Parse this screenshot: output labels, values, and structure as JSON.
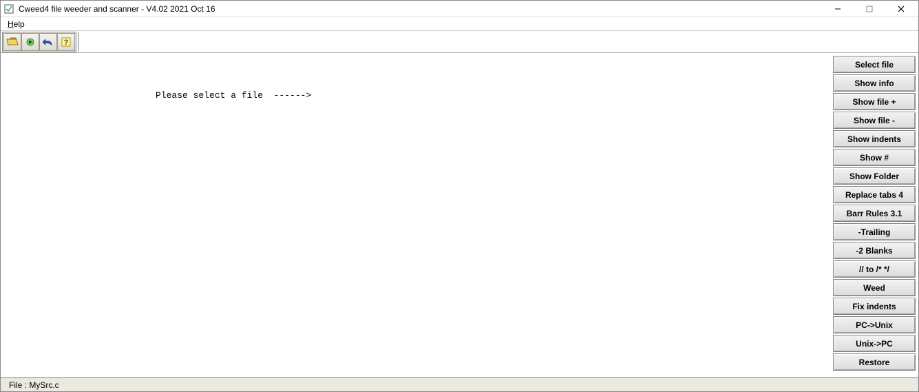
{
  "window": {
    "title": "Cweed4 file weeder and scanner - V4.02 2021 Oct 16"
  },
  "menu": {
    "help": "Help"
  },
  "main": {
    "prompt": "Please select a file  ------>"
  },
  "side": {
    "select_file": "Select file",
    "show_info": "Show info",
    "show_file_plus": "Show file +",
    "show_file_minus": "Show file -",
    "show_indents": "Show indents",
    "show_hash": "Show #",
    "show_folder": "Show Folder",
    "replace_tabs": "Replace tabs 4",
    "barr_rules": "Barr Rules 3.1",
    "trailing": "-Trailing",
    "two_blanks": "-2 Blanks",
    "to_comment": "// to /* */",
    "weed": "Weed",
    "fix_indents": "Fix indents",
    "pc_unix": "PC->Unix",
    "unix_pc": "Unix->PC",
    "restore": "Restore"
  },
  "status": {
    "file": "File : MySrc.c"
  }
}
